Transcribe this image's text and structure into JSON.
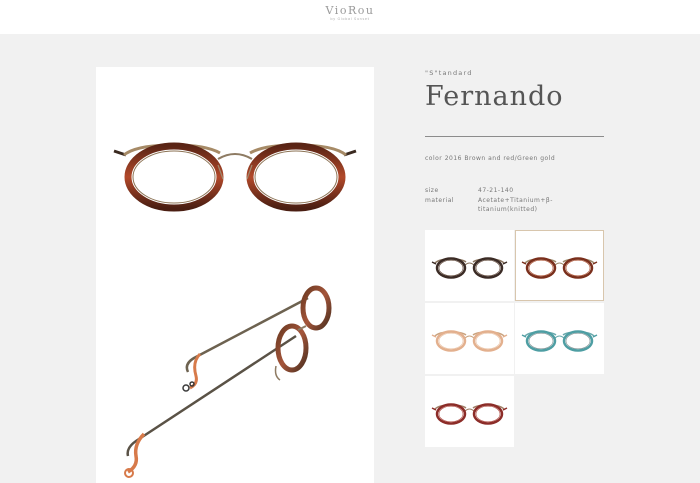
{
  "brand": {
    "name": "VioRou",
    "tagline": "by Global Sunset"
  },
  "product": {
    "series": "\"S\"tandard",
    "model": "Fernando",
    "color_label": "color",
    "color_value": "2016 Brown and red/Green gold",
    "specs": [
      {
        "key": "size",
        "value": "47-21-140"
      },
      {
        "key": "material",
        "value": "Acetate+Titanium+β-titanium(knitted)"
      }
    ]
  },
  "images": {
    "front_view": "front-view-glasses-icon",
    "angle_view": "angle-view-glasses-icon"
  },
  "variants": [
    {
      "icon": "glasses-dark-brown-icon",
      "frame": "#3b2b25",
      "rim": "#5a4030",
      "bridge": "#8a7560",
      "selected": false
    },
    {
      "icon": "glasses-brown-red-icon",
      "frame": "#7a2f1c",
      "rim": "#a84a2a",
      "bridge": "#9c8a6d",
      "selected": true
    },
    {
      "icon": "glasses-peach-icon",
      "frame": "#e3b08e",
      "rim": "#e9c1a3",
      "bridge": "#c9a37f",
      "selected": false
    },
    {
      "icon": "glasses-teal-icon",
      "frame": "#4e9ea3",
      "rim": "#7a8a8c",
      "bridge": "#6aa9ad",
      "selected": false
    },
    {
      "icon": "glasses-red-icon",
      "frame": "#8c2c28",
      "rim": "#b04a42",
      "bridge": "#a08068",
      "selected": false
    }
  ]
}
